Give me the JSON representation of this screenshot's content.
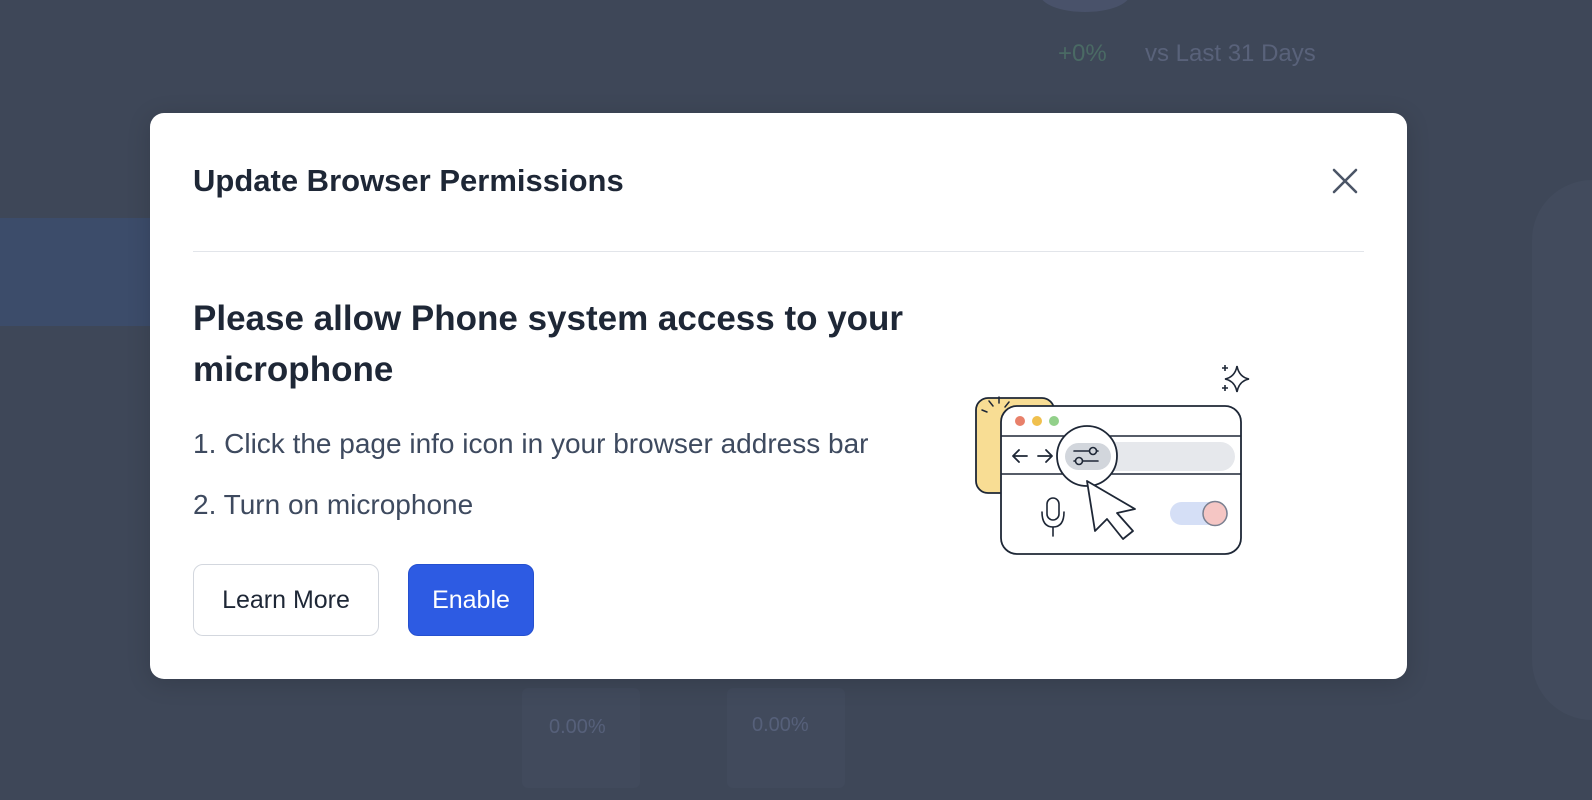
{
  "background": {
    "trend_value": "+0%",
    "comparison_text": "vs Last 31 Days",
    "stat_1": "0.00%",
    "stat_2": "0.00%"
  },
  "modal": {
    "title": "Update Browser Permissions",
    "heading": "Please allow Phone system access to your microphone",
    "steps": [
      "1. Click the page info icon in your browser address bar",
      "2. Turn on microphone"
    ],
    "learn_more_label": "Learn More",
    "enable_label": "Enable",
    "close_icon": "close-icon",
    "illustration": "browser-permissions-illustration"
  },
  "colors": {
    "overlay": "#3e4758",
    "primary": "#2d5be3",
    "title_text": "#1e2736",
    "body_text": "#3e4a5f",
    "illustration_accent_yellow": "#f8dd94",
    "toggle_track": "#d5dff6",
    "toggle_knob": "#f5c6c4"
  }
}
